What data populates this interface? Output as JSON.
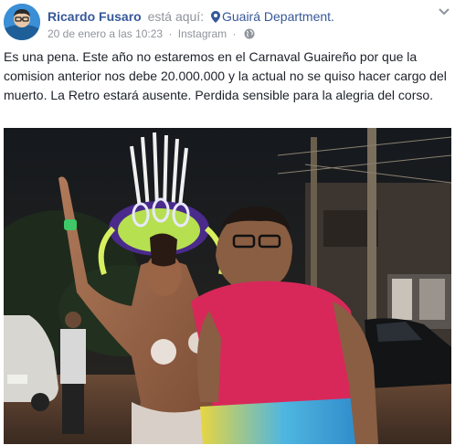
{
  "post": {
    "author": "Ricardo Fusaro",
    "action": "está aquí:",
    "location": "Guairá Department.",
    "timestamp": "20 de enero a las 10:23",
    "separator": "·",
    "source": "Instagram",
    "privacy_icon": "globe-icon",
    "location_icon": "pin-icon",
    "body": "Es una pena. Este año no estaremos en el Carnaval Guaireño por que la comision anterior nos debe 20.000.000 y la actual no se quiso hacer cargo del muerto. La Retro estará ausente. Perdida sensible para la alegria del corso."
  },
  "colors": {
    "link": "#365899",
    "secondary": "#90949c",
    "text": "#1d2129"
  }
}
